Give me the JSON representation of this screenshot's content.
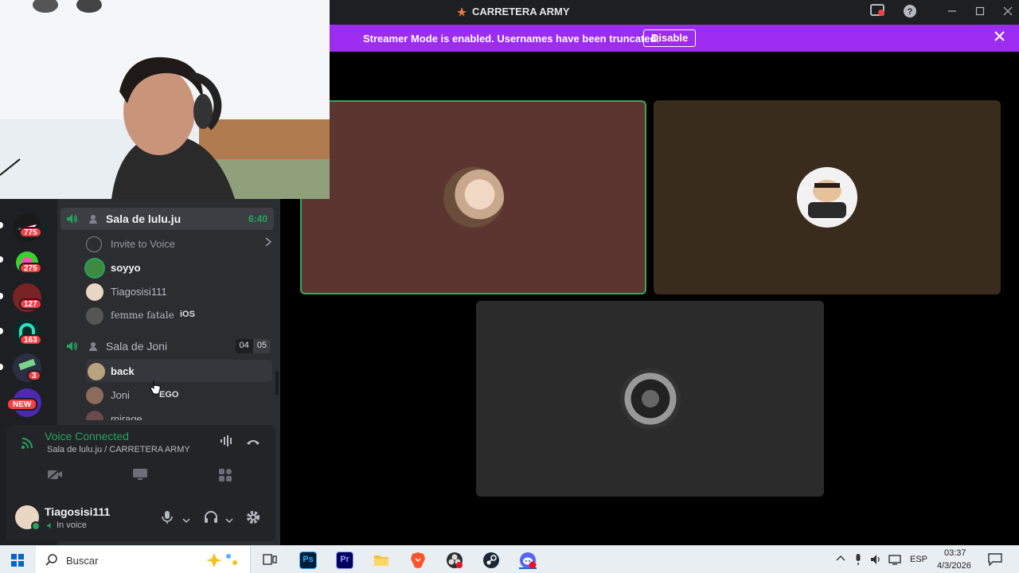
{
  "window": {
    "title": "CARRETERA ARMY"
  },
  "banner": {
    "message": "Streamer Mode is enabled. Usernames have been truncated.",
    "disable_label": "Disable"
  },
  "guilds": [
    {
      "badge": "775"
    },
    {
      "badge": "275"
    },
    {
      "badge": "127"
    },
    {
      "badge": "163"
    },
    {
      "badge": "3"
    },
    {
      "badge": "NEW"
    }
  ],
  "channels": {
    "room1": {
      "name": "Sala de lulu.ju",
      "time": "6:40",
      "invite_label": "Invite to Voice",
      "users": [
        {
          "name": "soyyo"
        },
        {
          "name": "Tiagosisi111"
        },
        {
          "name": "femme fatale",
          "tag": "iOS"
        }
      ]
    },
    "room2": {
      "name": "Sala de Joni",
      "count_a": "04",
      "count_b": "05",
      "users": [
        {
          "name": "back"
        },
        {
          "name": "Joni",
          "tag": "EGO"
        },
        {
          "name": "mirage"
        }
      ]
    }
  },
  "voice": {
    "status": "Voice Connected",
    "location": "Sala de lulu.ju / CARRETERA ARMY"
  },
  "user": {
    "name": "Tiagosisi111",
    "status": "In voice"
  },
  "taskbar": {
    "search_label": "Buscar",
    "lang": "ESP",
    "time": "03:37",
    "date": "4/3/2026"
  },
  "colors": {
    "accent": "#9b2cf0",
    "voice_green": "#23a55a",
    "badge_red": "#f23f43"
  }
}
